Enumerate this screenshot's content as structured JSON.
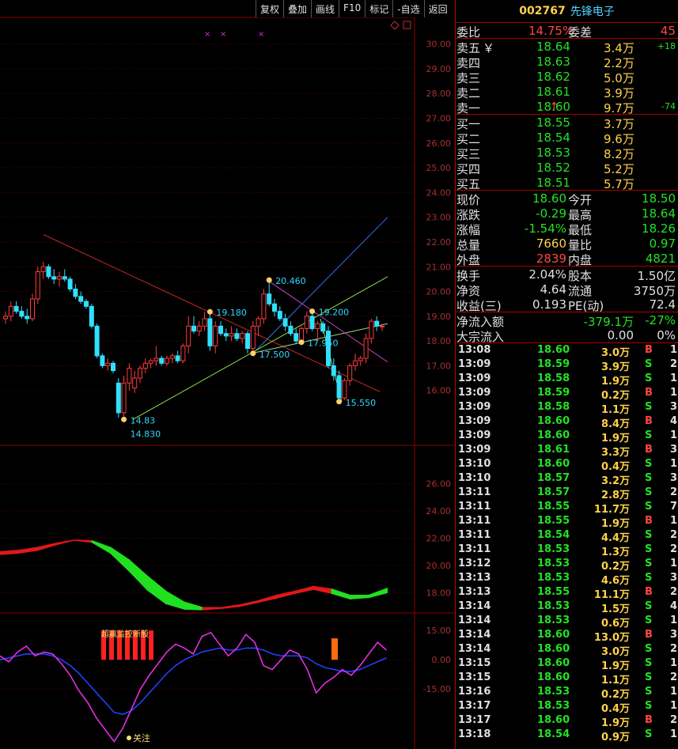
{
  "toolbar": [
    "复权",
    "叠加",
    "画线",
    "F10",
    "标记",
    "-自选",
    "返回"
  ],
  "stock": {
    "code": "002767",
    "name": "先锋电子"
  },
  "weibi": {
    "label1": "委比",
    "value1": "14.75%",
    "label2": "委差",
    "value2": "45"
  },
  "asks": [
    {
      "label": "卖五",
      "mark": "￥",
      "price": "18.64",
      "vol": "3.4万",
      "chg": "+18"
    },
    {
      "label": "卖四",
      "mark": "",
      "price": "18.63",
      "vol": "2.2万",
      "chg": ""
    },
    {
      "label": "卖三",
      "mark": "",
      "price": "18.62",
      "vol": "5.0万",
      "chg": ""
    },
    {
      "label": "卖二",
      "mark": "",
      "price": "18.61",
      "vol": "3.9万",
      "chg": ""
    },
    {
      "label": "卖一",
      "mark": "↑",
      "price": "18.60",
      "vol": "9.7万",
      "chg": "-74"
    }
  ],
  "bids": [
    {
      "label": "买一",
      "price": "18.55",
      "vol": "3.7万"
    },
    {
      "label": "买二",
      "price": "18.54",
      "vol": "9.6万"
    },
    {
      "label": "买三",
      "price": "18.53",
      "vol": "8.2万"
    },
    {
      "label": "买四",
      "price": "18.52",
      "vol": "5.2万"
    },
    {
      "label": "买五",
      "price": "18.51",
      "vol": "5.7万"
    }
  ],
  "quote": [
    {
      "l1": "现价",
      "v1": "18.60",
      "c1": "g",
      "l2": "今开",
      "v2": "18.50",
      "c2": "g"
    },
    {
      "l1": "涨跌",
      "v1": "-0.29",
      "c1": "g",
      "l2": "最高",
      "v2": "18.64",
      "c2": "g"
    },
    {
      "l1": "涨幅",
      "v1": "-1.54%",
      "c1": "g",
      "l2": "最低",
      "v2": "18.26",
      "c2": "g"
    },
    {
      "l1": "总量",
      "v1": "7660",
      "c1": "y",
      "l2": "量比",
      "v2": "0.97",
      "c2": "g"
    },
    {
      "l1": "外盘",
      "v1": "2839",
      "c1": "r",
      "l2": "内盘",
      "v2": "4821",
      "c2": "g"
    }
  ],
  "fin": [
    {
      "l1": "换手",
      "v1": "2.04%",
      "l2": "股本",
      "v2": "1.50亿"
    },
    {
      "l1": "净资",
      "v1": "4.64",
      "l2": "流通",
      "v2": "3750万"
    },
    {
      "l1": "收益(三)",
      "v1": "0.193",
      "l2": "PE(动)",
      "v2": "72.4"
    }
  ],
  "flow": [
    {
      "label": "净流入额",
      "v1": "-379.1万",
      "v2": "-27%",
      "c": "g"
    },
    {
      "label": "大宗流入",
      "v1": "0.00",
      "v2": "0%",
      "c": "w"
    }
  ],
  "trades": [
    [
      "13:08",
      "18.60",
      "3.0万",
      "B",
      "1"
    ],
    [
      "13:09",
      "18.59",
      "3.9万",
      "S",
      "2"
    ],
    [
      "13:09",
      "18.58",
      "1.9万",
      "S",
      "1"
    ],
    [
      "13:09",
      "18.59",
      "0.2万",
      "B",
      "1"
    ],
    [
      "13:09",
      "18.58",
      "1.1万",
      "S",
      "3"
    ],
    [
      "13:09",
      "18.60",
      "8.4万",
      "B",
      "4"
    ],
    [
      "13:09",
      "18.60",
      "1.9万",
      "S",
      "1"
    ],
    [
      "13:09",
      "18.61",
      "3.3万",
      "B",
      "3"
    ],
    [
      "13:10",
      "18.60",
      "0.4万",
      "S",
      "1"
    ],
    [
      "13:10",
      "18.57",
      "3.2万",
      "S",
      "3"
    ],
    [
      "13:11",
      "18.57",
      "2.8万",
      "S",
      "2"
    ],
    [
      "13:11",
      "18.55",
      "11.7万",
      "S",
      "7"
    ],
    [
      "13:11",
      "18.55",
      "1.9万",
      "B",
      "1"
    ],
    [
      "13:11",
      "18.54",
      "4.4万",
      "S",
      "2"
    ],
    [
      "13:11",
      "18.53",
      "1.3万",
      "S",
      "2"
    ],
    [
      "13:12",
      "18.53",
      "0.2万",
      "S",
      "1"
    ],
    [
      "13:13",
      "18.53",
      "4.6万",
      "S",
      "3"
    ],
    [
      "13:13",
      "18.55",
      "11.1万",
      "B",
      "2"
    ],
    [
      "13:14",
      "18.53",
      "1.5万",
      "S",
      "4"
    ],
    [
      "13:14",
      "18.53",
      "0.6万",
      "S",
      "1"
    ],
    [
      "13:14",
      "18.60",
      "13.0万",
      "B",
      "3"
    ],
    [
      "13:14",
      "18.60",
      "3.0万",
      "S",
      "2"
    ],
    [
      "13:15",
      "18.60",
      "1.9万",
      "S",
      "1"
    ],
    [
      "13:15",
      "18.60",
      "1.1万",
      "S",
      "2"
    ],
    [
      "13:16",
      "18.53",
      "0.2万",
      "S",
      "1"
    ],
    [
      "13:17",
      "18.53",
      "0.4万",
      "S",
      "1"
    ],
    [
      "13:17",
      "18.60",
      "1.9万",
      "B",
      "2"
    ],
    [
      "13:18",
      "18.54",
      "0.9万",
      "S",
      "1"
    ]
  ],
  "chart_data": {
    "type": "candlestick",
    "price_axis": [
      "30.00",
      "29.00",
      "28.00",
      "27.00",
      "26.00",
      "25.00",
      "24.00",
      "23.00",
      "22.00",
      "21.00",
      "20.00",
      "19.00",
      "18.00",
      "17.00",
      "16.00"
    ],
    "price_ylim": [
      15.0,
      30.5
    ],
    "annotations": [
      {
        "text": "14.83",
        "x": 22,
        "y": 14.83
      },
      {
        "text": "14.830",
        "x": 22,
        "y": 14.5
      },
      {
        "text": "19.180",
        "x": 38,
        "y": 19.18
      },
      {
        "text": "20.460",
        "x": 49,
        "y": 20.46
      },
      {
        "text": "17.500",
        "x": 46,
        "y": 17.5
      },
      {
        "text": "19.200",
        "x": 57,
        "y": 19.2
      },
      {
        "text": "17.950",
        "x": 55,
        "y": 17.95
      },
      {
        "text": "15.550",
        "x": 62,
        "y": 15.55
      }
    ],
    "candles": [
      [
        18.9,
        19.2,
        18.7,
        19.0
      ],
      [
        19.0,
        19.6,
        18.8,
        19.4
      ],
      [
        19.4,
        19.6,
        19.1,
        19.2
      ],
      [
        19.2,
        19.4,
        18.9,
        19.0
      ],
      [
        19.0,
        19.3,
        18.7,
        18.9
      ],
      [
        18.9,
        19.9,
        18.8,
        19.7
      ],
      [
        19.7,
        21.0,
        19.5,
        20.8
      ],
      [
        20.8,
        21.2,
        20.5,
        21.0
      ],
      [
        21.0,
        21.1,
        20.5,
        20.6
      ],
      [
        20.6,
        20.9,
        20.3,
        20.5
      ],
      [
        20.5,
        20.8,
        20.2,
        20.6
      ],
      [
        20.6,
        20.9,
        20.4,
        20.5
      ],
      [
        20.5,
        20.6,
        20.0,
        20.1
      ],
      [
        20.1,
        20.3,
        19.7,
        19.8
      ],
      [
        19.8,
        20.0,
        19.5,
        19.6
      ],
      [
        19.6,
        19.7,
        19.3,
        19.4
      ],
      [
        19.4,
        19.5,
        18.5,
        18.6
      ],
      [
        18.6,
        18.7,
        17.3,
        17.4
      ],
      [
        17.4,
        17.5,
        16.9,
        17.0
      ],
      [
        17.0,
        17.3,
        16.8,
        17.1
      ],
      [
        17.1,
        17.2,
        16.7,
        16.8
      ],
      [
        16.3,
        16.5,
        14.9,
        15.1
      ],
      [
        15.1,
        16.6,
        14.83,
        16.3
      ],
      [
        16.3,
        17.1,
        16.0,
        16.9
      ],
      [
        16.1,
        16.8,
        15.9,
        16.5
      ],
      [
        16.5,
        17.0,
        16.3,
        16.9
      ],
      [
        16.9,
        17.3,
        16.7,
        17.1
      ],
      [
        17.1,
        17.3,
        16.9,
        17.2
      ],
      [
        17.2,
        17.8,
        17.0,
        17.3
      ],
      [
        17.3,
        17.4,
        17.0,
        17.1
      ],
      [
        17.1,
        17.4,
        17.0,
        17.3
      ],
      [
        17.3,
        17.5,
        17.1,
        17.4
      ],
      [
        17.4,
        17.6,
        17.1,
        17.2
      ],
      [
        17.2,
        17.9,
        17.1,
        17.8
      ],
      [
        17.8,
        19.0,
        17.5,
        18.6
      ],
      [
        18.6,
        19.0,
        18.3,
        18.4
      ],
      [
        18.4,
        18.8,
        18.2,
        18.6
      ],
      [
        18.6,
        19.18,
        18.4,
        18.9
      ],
      [
        18.9,
        19.2,
        17.6,
        17.8
      ],
      [
        17.8,
        18.8,
        17.5,
        18.6
      ],
      [
        18.6,
        18.8,
        18.2,
        18.3
      ],
      [
        18.3,
        18.5,
        18.0,
        18.2
      ],
      [
        18.2,
        18.6,
        18.0,
        18.3
      ],
      [
        18.3,
        18.5,
        18.0,
        18.1
      ],
      [
        18.1,
        18.4,
        17.9,
        18.3
      ],
      [
        18.3,
        18.4,
        17.5,
        17.7
      ],
      [
        17.7,
        18.8,
        17.5,
        18.6
      ],
      [
        18.6,
        19.0,
        18.2,
        18.9
      ],
      [
        18.9,
        20.1,
        18.7,
        19.9
      ],
      [
        19.9,
        20.46,
        19.4,
        19.5
      ],
      [
        19.5,
        19.7,
        19.0,
        19.2
      ],
      [
        19.2,
        19.4,
        18.8,
        18.9
      ],
      [
        18.9,
        19.1,
        18.4,
        18.6
      ],
      [
        18.6,
        18.8,
        18.2,
        18.3
      ],
      [
        18.3,
        18.5,
        17.9,
        18.0
      ],
      [
        18.0,
        18.6,
        17.95,
        18.5
      ],
      [
        18.5,
        19.2,
        18.3,
        19.0
      ],
      [
        19.0,
        19.1,
        18.4,
        18.5
      ],
      [
        18.5,
        18.8,
        18.0,
        18.7
      ],
      [
        18.7,
        18.8,
        18.3,
        18.4
      ],
      [
        18.4,
        18.6,
        16.9,
        17.0
      ],
      [
        17.0,
        17.3,
        16.4,
        16.6
      ],
      [
        16.6,
        16.8,
        15.55,
        15.7
      ],
      [
        15.7,
        16.5,
        15.6,
        16.4
      ],
      [
        16.4,
        17.1,
        16.2,
        17.0
      ],
      [
        17.0,
        17.5,
        16.8,
        17.2
      ],
      [
        17.2,
        17.4,
        17.0,
        17.3
      ],
      [
        17.3,
        18.3,
        17.1,
        18.1
      ],
      [
        18.1,
        18.9,
        17.9,
        18.8
      ],
      [
        18.8,
        19.0,
        18.4,
        18.6
      ],
      [
        18.6,
        18.7,
        18.4,
        18.6
      ]
    ],
    "mid_axis": [
      "26.00",
      "24.00",
      "22.00",
      "20.00",
      "18.00"
    ],
    "mid_ylim": [
      16.8,
      28.4
    ],
    "band_upper": [
      21.0,
      21.1,
      21.3,
      21.6,
      21.85,
      21.8,
      21.3,
      20.4,
      19.2,
      18.1,
      17.3,
      16.9,
      16.9,
      17.1,
      17.4,
      17.8,
      18.1,
      18.45,
      18.25,
      17.8,
      17.8,
      18.3
    ],
    "band_lower": [
      20.8,
      20.9,
      21.1,
      21.5,
      21.85,
      21.7,
      20.9,
      19.6,
      18.2,
      17.2,
      16.8,
      16.75,
      16.85,
      17.0,
      17.3,
      17.6,
      17.95,
      18.25,
      17.95,
      17.55,
      17.65,
      18.0
    ],
    "band_colors": [
      "r",
      "r",
      "r",
      "r",
      "r",
      "g",
      "g",
      "g",
      "g",
      "g",
      "g",
      "r",
      "r",
      "r",
      "r",
      "r",
      "r",
      "r",
      "g",
      "g",
      "g",
      "r"
    ],
    "osc_axis": [
      "15.00",
      "0.00",
      "-15.00"
    ],
    "osc_ylim": [
      -45,
      22
    ],
    "osc_magenta": [
      2,
      -1,
      4,
      7,
      2,
      4,
      3,
      -2,
      -8,
      -16,
      -22,
      -30,
      -36,
      -42,
      -35,
      -25,
      -15,
      -8,
      -2,
      4,
      8,
      6,
      3,
      12,
      14,
      8,
      2,
      6,
      13,
      9,
      -3,
      -5,
      0,
      5,
      3,
      -5,
      -17,
      -12,
      -9,
      -5,
      -8,
      -3,
      3,
      9,
      5
    ],
    "osc_blue": [
      0,
      1,
      2,
      3,
      3,
      3,
      2,
      0,
      -3,
      -7,
      -12,
      -17,
      -22,
      -27,
      -28,
      -26,
      -22,
      -17,
      -12,
      -7,
      -3,
      0,
      2,
      4,
      5,
      6,
      5,
      5,
      6,
      6,
      5,
      3,
      2,
      2,
      2,
      1,
      -2,
      -4,
      -5,
      -6,
      -6,
      -5,
      -3,
      -1,
      1
    ],
    "osc_texts": [
      "超赢监控新股",
      "关注"
    ]
  }
}
